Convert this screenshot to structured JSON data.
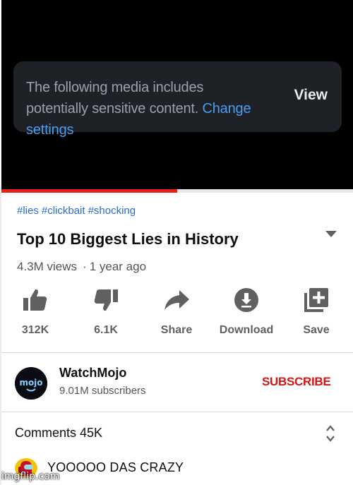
{
  "player": {
    "sensitive_text": "The following media includes potentially sensitive content.",
    "change_settings_link": "Change settings",
    "view_label": "View",
    "progress_fraction": 0.5,
    "colors": {
      "background": "#000000",
      "box": "#1e2126",
      "link": "#4a9df0",
      "progress": "#e62117"
    }
  },
  "video": {
    "hashtags": [
      "#lies",
      "#clickbait",
      "#shocking"
    ],
    "title": "Top 10 Biggest Lies in History",
    "views": "4.3M views",
    "age": "1 year ago",
    "expand_icon": "chevron-down-icon"
  },
  "actions": [
    {
      "id": "like",
      "icon": "thumbs-up-icon",
      "label": "312K"
    },
    {
      "id": "dislike",
      "icon": "thumbs-down-icon",
      "label": "6.1K"
    },
    {
      "id": "share",
      "icon": "share-icon",
      "label": "Share"
    },
    {
      "id": "download",
      "icon": "download-icon",
      "label": "Download"
    },
    {
      "id": "save",
      "icon": "playlist-add-icon",
      "label": "Save"
    }
  ],
  "channel": {
    "logo_text": "mojo",
    "name": "WatchMojo",
    "subscribers": "9.01M subscribers",
    "subscribe_label": "SUBSCRIBE",
    "subscribe_color": "#d11616"
  },
  "comments": {
    "title": "Comments 45K",
    "sort_icon": "unfold-icon",
    "top_comment": "YOOOOO DAS CRAZY",
    "avatar_icon": "among-us-crewmate-icon"
  },
  "watermark": "imgflip.com"
}
